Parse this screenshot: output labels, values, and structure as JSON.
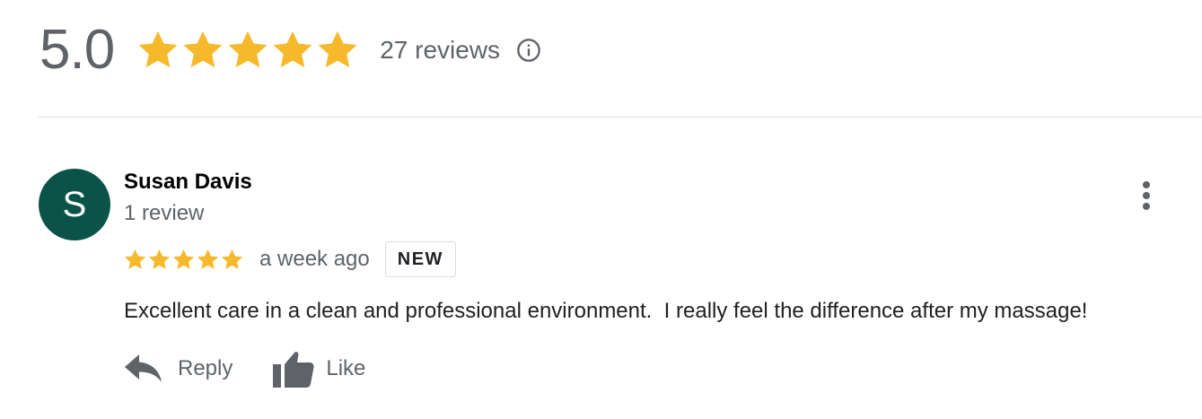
{
  "summary": {
    "score": "5.0",
    "star_count": 5,
    "review_count_label": "27 reviews",
    "info_icon": "info-icon"
  },
  "review": {
    "avatar_letter": "S",
    "reviewer_name": "Susan Davis",
    "reviewer_meta": "1 review",
    "rating": 5,
    "date": "a week ago",
    "badge": "NEW",
    "text": "Excellent care in a clean and professional environment.  I really feel the difference after my massage!",
    "actions": {
      "reply_label": "Reply",
      "like_label": "Like"
    },
    "more_icon": "more-vert-icon"
  },
  "colors": {
    "star": "#f6b92b",
    "avatar_bg": "#0b5349",
    "muted_text": "#5f6368",
    "divider": "#e0e0e0"
  }
}
